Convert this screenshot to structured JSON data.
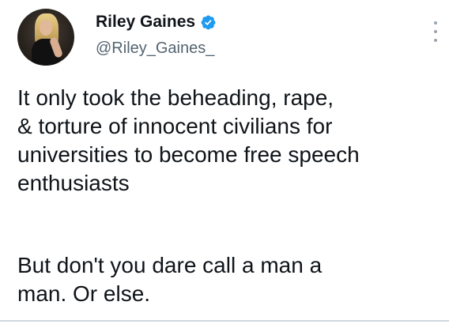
{
  "tweet": {
    "author": {
      "display_name": "Riley Gaines",
      "handle": "@Riley_Gaines_",
      "verified": true,
      "verified_color": "#1d9bf0"
    },
    "paragraphs": [
      "It only took the beheading, rape,\n& torture of innocent civilians for\nuniversities to become free speech\nenthusiasts",
      "But don't you dare call a man a\nman. Or else."
    ],
    "icons": {
      "avatar": "profile-photo",
      "verified": "verified-badge-icon",
      "more": "more-options-icon"
    }
  }
}
